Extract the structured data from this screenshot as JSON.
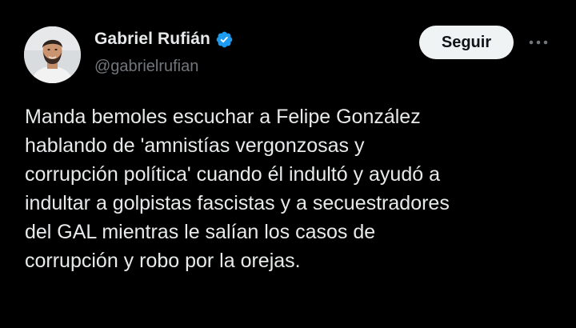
{
  "author": {
    "display_name": "Gabriel Rufián",
    "handle": "@gabrielrufian",
    "verified": true,
    "verified_color": "#1d9bf0"
  },
  "actions": {
    "follow_label": "Seguir",
    "more_icon": "more-horizontal-icon"
  },
  "tweet": {
    "lines": [
      "Manda bemoles escuchar a Felipe González",
      "hablando de 'amnistías vergonzosas y",
      "corrupción política' cuando él indultó y ayudó a",
      "indultar a golpistas fascistas y a secuestradores",
      "del GAL mientras le salían los casos de",
      "corrupción y robo por la orejas."
    ]
  },
  "colors": {
    "background": "#000000",
    "text_primary": "#e7e9ea",
    "text_secondary": "#71767b",
    "button_bg": "#eff3f4",
    "button_text": "#0f1419"
  }
}
